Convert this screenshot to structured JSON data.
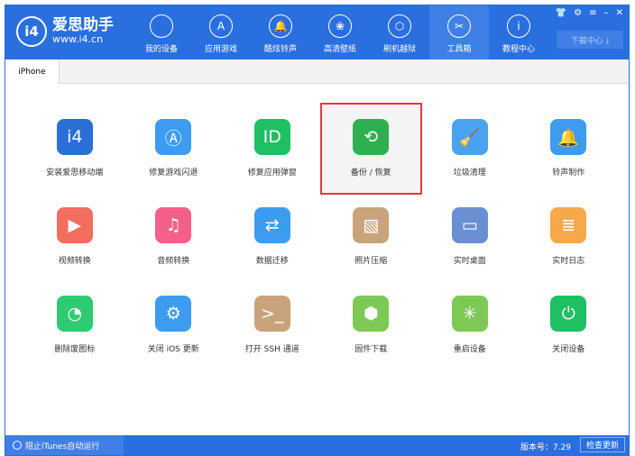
{
  "app": {
    "title": "爱思助手",
    "url": "www.i4.cn",
    "logo": "i4"
  },
  "nav": [
    {
      "label": "我的设备",
      "icon": ""
    },
    {
      "label": "应用游戏",
      "icon": "A"
    },
    {
      "label": "酷炫铃声",
      "icon": "🔔"
    },
    {
      "label": "高清壁纸",
      "icon": "❀"
    },
    {
      "label": "刷机越狱",
      "icon": "⬡"
    },
    {
      "label": "工具箱",
      "icon": "✂"
    },
    {
      "label": "教程中心",
      "icon": "i"
    }
  ],
  "window_controls": [
    "👕",
    "⚙",
    "≡",
    "–",
    "✕"
  ],
  "download_center": "下载中心 ⤓",
  "tab": "iPhone",
  "tools": [
    {
      "label": "安装爱思移动端",
      "icon": "i4",
      "color": "#2a6fd6"
    },
    {
      "label": "修复游戏闪退",
      "icon": "Ⓐ",
      "color": "#3d9cf0"
    },
    {
      "label": "修复应用弹窗",
      "icon": "ID",
      "color": "#1fbf64"
    },
    {
      "label": "备份 / 恢复",
      "icon": "⟲",
      "color": "#2fb050"
    },
    {
      "label": "垃圾清理",
      "icon": "🧹",
      "color": "#4aa3ef"
    },
    {
      "label": "铃声制作",
      "icon": "🔔",
      "color": "#3d9cf0"
    },
    {
      "label": "视频转换",
      "icon": "▶",
      "color": "#f36e5e"
    },
    {
      "label": "音频转换",
      "icon": "♫",
      "color": "#f5608a"
    },
    {
      "label": "数据迁移",
      "icon": "⇄",
      "color": "#3d9cf0"
    },
    {
      "label": "照片压缩",
      "icon": "▧",
      "color": "#c9a47b"
    },
    {
      "label": "实时桌面",
      "icon": "▭",
      "color": "#6a8fd2"
    },
    {
      "label": "实时日志",
      "icon": "≣",
      "color": "#f7a84a"
    },
    {
      "label": "删除废图标",
      "icon": "◔",
      "color": "#2ecc71"
    },
    {
      "label": "关闭 iOS 更新",
      "icon": "⚙",
      "color": "#3d9cf0"
    },
    {
      "label": "打开 SSH 通道",
      "icon": ">_",
      "color": "#c9a47b"
    },
    {
      "label": "固件下载",
      "icon": "⬢",
      "color": "#7ec855"
    },
    {
      "label": "重启设备",
      "icon": "✳",
      "color": "#7ec855"
    },
    {
      "label": "关闭设备",
      "icon": "⏻",
      "color": "#1fbf64"
    }
  ],
  "selected_tool": 3,
  "footer": {
    "itunes": "阻止iTunes自动运行",
    "version": "版本号：7.29",
    "update": "检查更新"
  }
}
